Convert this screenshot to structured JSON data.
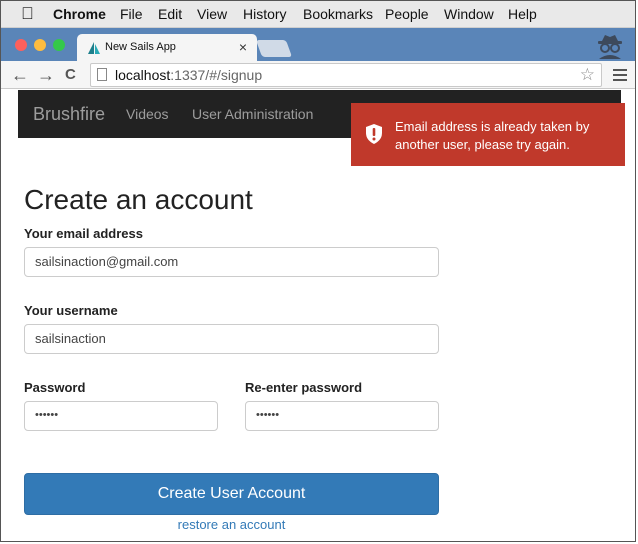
{
  "menubar": {
    "app": "Chrome",
    "items": [
      "File",
      "Edit",
      "View",
      "History",
      "Bookmarks",
      "People",
      "Window",
      "Help"
    ]
  },
  "browser": {
    "tab_title": "New Sails App",
    "tab_close": "×",
    "url_host": "localhost",
    "url_rest": ":1337/#/signup",
    "back": "←",
    "forward": "→",
    "reload": "C",
    "star": "☆"
  },
  "navbar": {
    "brand": "Brushfire",
    "links": [
      "Videos",
      "User Administration"
    ]
  },
  "alert": {
    "message": "Email address is already taken by another user, please try again.",
    "color": "#c0392b"
  },
  "form": {
    "title": "Create an account",
    "email_label": "Your email address",
    "email_value": "sailsinaction@gmail.com",
    "username_label": "Your username",
    "username_value": "sailsinaction",
    "password_label": "Password",
    "password_value": "••••••",
    "confirm_label": "Re-enter password",
    "confirm_value": "••••••",
    "submit_label": "Create User Account",
    "restore_label": "restore an account",
    "accent": "#337ab7"
  }
}
